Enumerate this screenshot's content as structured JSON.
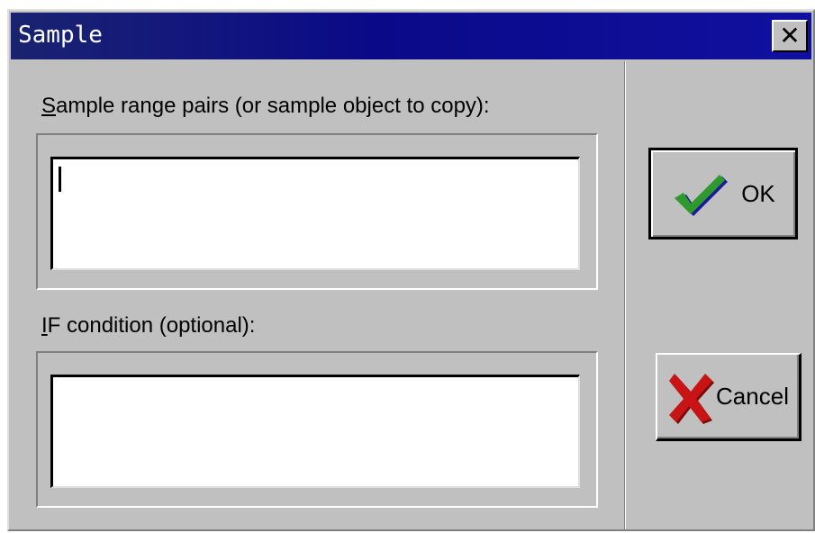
{
  "window": {
    "title": "Sample",
    "close_symbol": "✕"
  },
  "sample_range": {
    "label_mnemonic": "S",
    "label_rest": "ample range pairs (or sample object to copy):",
    "value": ""
  },
  "if_condition": {
    "label_mnemonic": "I",
    "label_rest": "F condition (optional):",
    "value": ""
  },
  "buttons": {
    "ok_label": "OK",
    "ok_icon": "checkmark-icon",
    "cancel_label": "Cancel",
    "cancel_icon": "red-x-icon"
  },
  "colors": {
    "titlebar": "#0a0a88",
    "face": "#c0c0c0",
    "check_green": "#2e9a2e",
    "check_blue": "#1a1a9a",
    "cancel_red": "#c81414"
  }
}
